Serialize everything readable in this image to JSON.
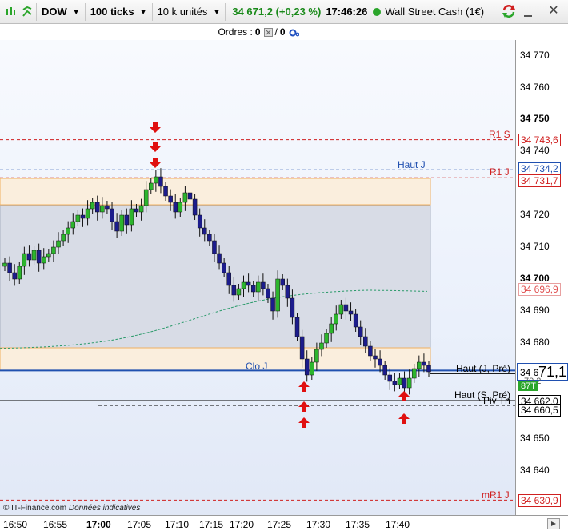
{
  "toolbar": {
    "symbol": "DOW",
    "ticks": "100 ticks",
    "units": "10 k unités",
    "price": "34 671,2 (+0,23 %)",
    "time": "17:46:26",
    "instrument": "Wall Street Cash (1€)"
  },
  "orders": {
    "label": "Ordres :",
    "count_a": "0",
    "sep": "/",
    "count_b": "0"
  },
  "price_axis": {
    "labels": [
      "34 770",
      "34 760",
      "34 750",
      "34 740",
      "34 720",
      "34 710",
      "34 700",
      "34 690",
      "34 680",
      "34 650",
      "34 640"
    ],
    "bold_labels": [
      "34 750",
      "34 700"
    ],
    "r1s": "34 743,6",
    "r1j": "34 731,7",
    "hautj": "34 734,2",
    "ma": "34 696,9",
    "current_main": "34 6",
    "current_big": "71,1",
    "current_small": "70,2",
    "count_badge": "87T",
    "piv": "34 662,0",
    "s_pre": "34 660,5",
    "mr1j": "34 630,9"
  },
  "lines": {
    "r1s_label": "R1 S",
    "r1j_label": "R1 J",
    "hautj_label": "Haut J",
    "cloj_label": "Clo J",
    "haut_jpre_label": "Haut (J, Pré)",
    "haut_spre_label": "Haut (S, Pré)",
    "piv_label": "Piv Th",
    "mr1j_label": "mR1 J"
  },
  "time_axis": {
    "labels": [
      "16:50",
      "16:55",
      "17:00",
      "17:05",
      "17:10",
      "17:15",
      "17:20",
      "17:25",
      "17:30",
      "17:35",
      "17:40"
    ],
    "bold": [
      "17:00"
    ]
  },
  "footer": {
    "copyright": "© IT-Finance.com",
    "note": "Données indicatives"
  },
  "chart_data": {
    "type": "candlestick",
    "y_range": [
      34625,
      34775
    ],
    "series_color_up": "#2db52d",
    "series_color_down": "#1c1c8c",
    "levels": {
      "R1 S": 34743.6,
      "Haut J": 34734.2,
      "R1 J": 34731.7,
      "Clo J": 34670.9,
      "Haut (J, Pré)": 34671.0,
      "Haut (S, Pré)": 34662.0,
      "Piv Th": 34660.5,
      "mR1 J": 34630.9
    },
    "closes": [
      34705,
      34702,
      34700,
      34704,
      34708,
      34706,
      34709,
      34705,
      34707,
      34708,
      34710,
      34712,
      34714,
      34716,
      34718,
      34720,
      34719,
      34722,
      34724,
      34721,
      34723,
      34722,
      34718,
      34715,
      34720,
      34717,
      34722,
      34721,
      34723,
      34728,
      34730,
      34732,
      34729,
      34726,
      34724,
      34721,
      34724,
      34727,
      34725,
      34720,
      34716,
      34714,
      34712,
      34708,
      34705,
      34702,
      34698,
      34695,
      34697,
      34699,
      34698,
      34696,
      34699,
      34697,
      34694,
      34690,
      34700,
      34698,
      34694,
      34688,
      34682,
      34675,
      34670,
      34674,
      34678,
      34680,
      34683,
      34686,
      34689,
      34692,
      34690,
      34689,
      34685,
      34682,
      34679,
      34676,
      34675,
      34673,
      34670,
      34668,
      34667,
      34669,
      34666,
      34669,
      34672,
      34674,
      34673,
      34671
    ]
  }
}
